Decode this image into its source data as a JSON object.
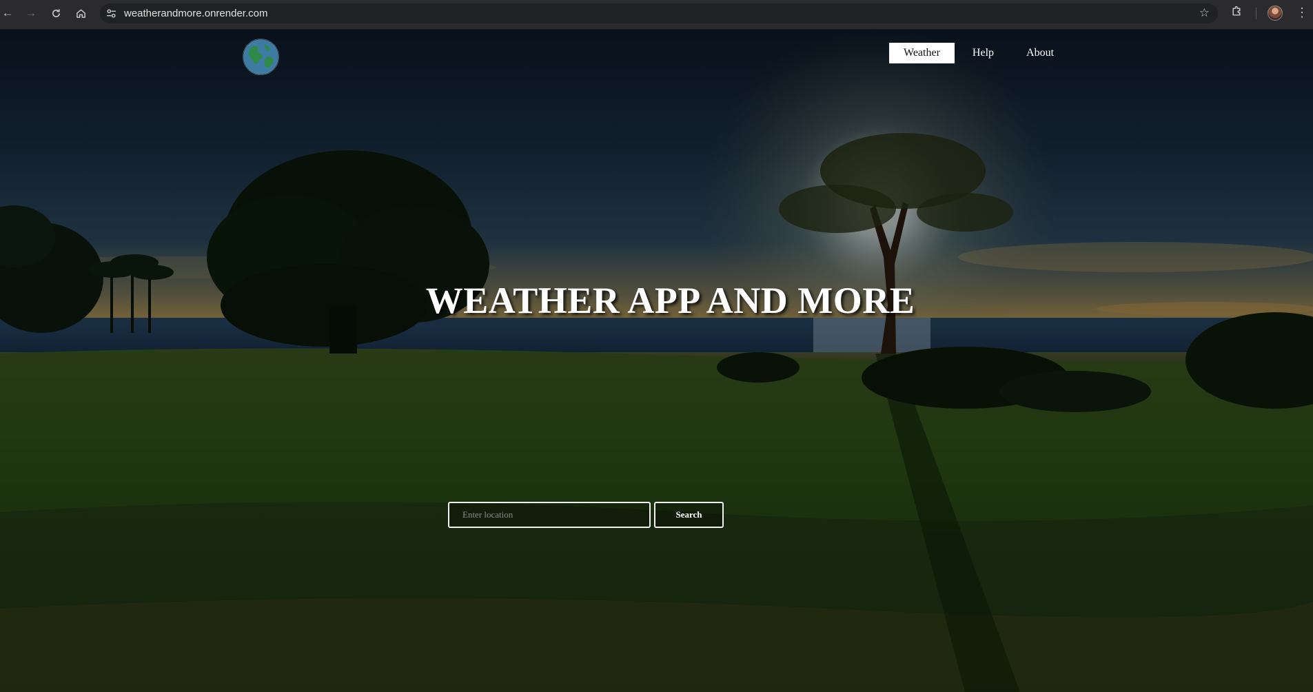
{
  "browser": {
    "url": "weatherandmore.onrender.com",
    "icons": {
      "back": "arrow-left-icon",
      "forward": "arrow-right-icon",
      "reload": "reload-icon",
      "home": "home-icon",
      "site_info": "tune-icon",
      "bookmark": "star-icon",
      "extensions": "puzzle-icon",
      "profile": "avatar",
      "menu": "kebab-menu-icon"
    }
  },
  "header": {
    "logo": "globe-icon",
    "nav": [
      {
        "label": "Weather",
        "active": true
      },
      {
        "label": "Help",
        "active": false
      },
      {
        "label": "About",
        "active": false
      }
    ]
  },
  "hero": {
    "title": "WEATHER APP AND MORE"
  },
  "search": {
    "placeholder": "Enter location",
    "value": "",
    "button_label": "Search"
  },
  "colors": {
    "nav_active_bg": "#ffffff",
    "nav_active_text": "#111111",
    "text": "#ffffff",
    "chrome_bg": "#2b2b2d",
    "omnibox_bg": "#202124"
  }
}
